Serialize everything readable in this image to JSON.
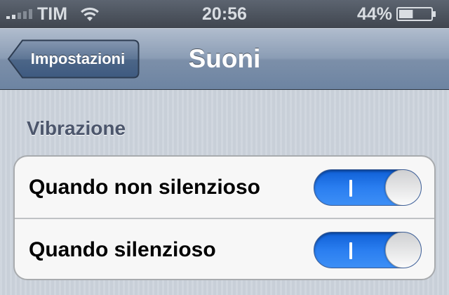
{
  "status_bar": {
    "carrier": "TIM",
    "time": "20:56",
    "battery_percent": "44%",
    "battery_level": 0.44,
    "signal_bars": 2,
    "signal_bars_total": 5,
    "icons": [
      "signal-icon",
      "wifi-icon",
      "battery-icon"
    ]
  },
  "nav_bar": {
    "back_label": "Impostazioni",
    "title": "Suoni"
  },
  "section": {
    "header": "Vibrazione",
    "rows": [
      {
        "label": "Quando non silenzioso",
        "switch_on": true
      },
      {
        "label": "Quando silenzioso",
        "switch_on": true
      }
    ]
  },
  "colors": {
    "switch_on": "#2a7ef0",
    "nav_bar": "#8b9db5",
    "background": "#cbd2db"
  }
}
